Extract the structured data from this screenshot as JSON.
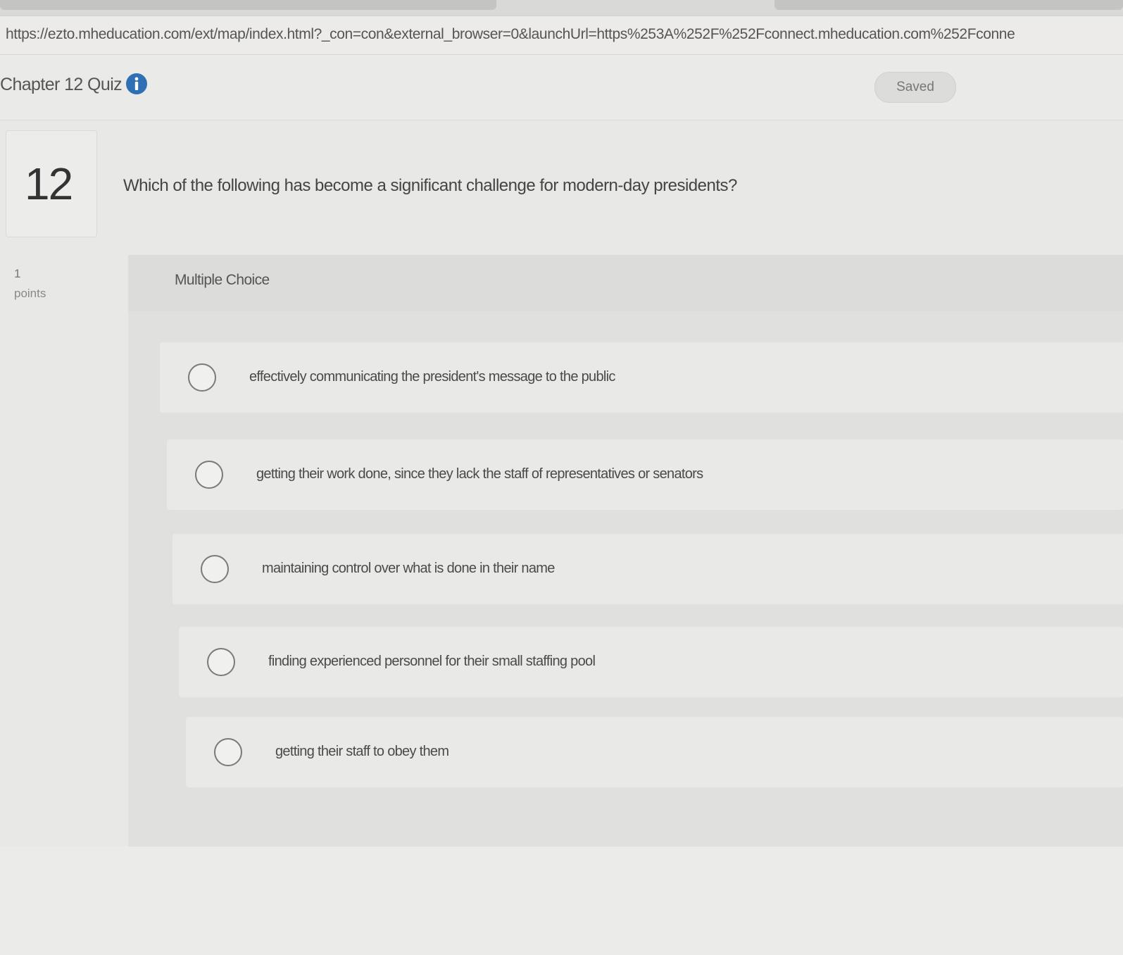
{
  "browser": {
    "url": "https://ezto.mheducation.com/ext/map/index.html?_con=con&external_browser=0&launchUrl=https%253A%252F%252Fconnect.mheducation.com%252Fconne"
  },
  "header": {
    "quiz_title": "Chapter 12 Quiz",
    "info_icon": "info-icon",
    "status": "Saved"
  },
  "question": {
    "number": "12",
    "text": "Which of the following has become a significant challenge for modern-day presidents?",
    "points_value": "1",
    "points_label": "points",
    "type": "Multiple Choice",
    "options": [
      {
        "text": "effectively communicating the president's message to the public"
      },
      {
        "text": "getting their work done, since they lack the staff of representatives or senators"
      },
      {
        "text": "maintaining control over what is done in their name"
      },
      {
        "text": "finding experienced personnel for their small staffing pool"
      },
      {
        "text": "getting their staff to obey them"
      }
    ]
  },
  "colors": {
    "info_icon": "#2f6fb4",
    "page_background": "#e8e8e6",
    "radio_border": "#7a7a7a"
  }
}
